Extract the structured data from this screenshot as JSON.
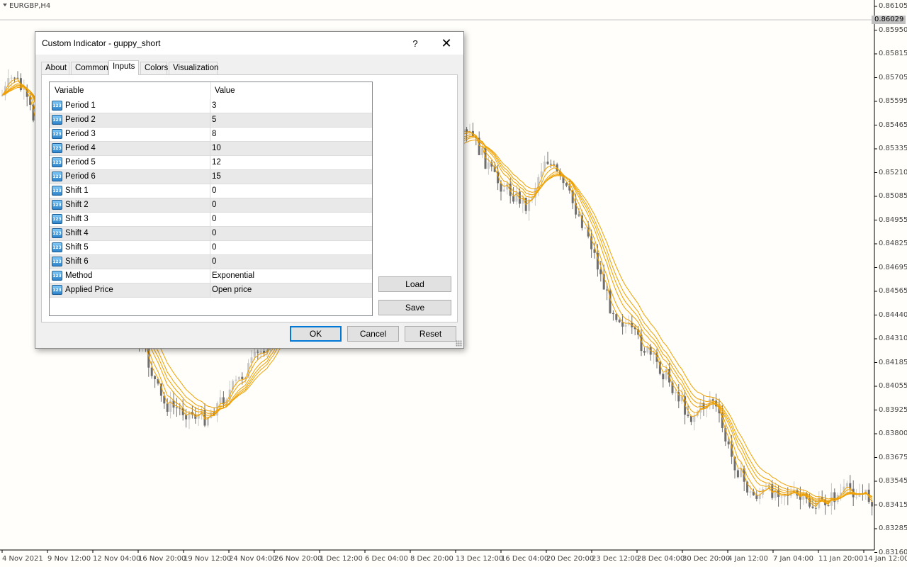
{
  "chart": {
    "symbol_label": "EURGBP,H4",
    "current_price": "0.86029",
    "y_labels": [
      "0.86105",
      "0.85950",
      "0.85815",
      "0.85705",
      "0.85595",
      "0.85465",
      "0.85335",
      "0.85210",
      "0.85085",
      "0.84955",
      "0.84825",
      "0.84695",
      "0.84565",
      "0.84440",
      "0.84310",
      "0.84185",
      "0.84055",
      "0.83925",
      "0.83800",
      "0.83675",
      "0.83545",
      "0.83415",
      "0.83285",
      "0.83160"
    ],
    "x_labels": [
      "4 Nov 2021",
      "9 Nov 12:00",
      "12 Nov 04:00",
      "16 Nov 20:00",
      "19 Nov 12:00",
      "24 Nov 04:00",
      "26 Nov 20:00",
      "1 Dec 12:00",
      "6 Dec 04:00",
      "8 Dec 20:00",
      "13 Dec 12:00",
      "16 Dec 04:00",
      "20 Dec 20:00",
      "23 Dec 12:00",
      "28 Dec 04:00",
      "30 Dec 20:00",
      "4 Jan 12:00",
      "7 Jan 04:00",
      "11 Jan 20:00",
      "14 Jan 12:00"
    ],
    "colors": {
      "ribbon": "#f0a000",
      "bull": "#c8c8c8",
      "bear": "#6e6e6e",
      "background": "#fffefa"
    }
  },
  "dialog": {
    "title": "Custom Indicator - guppy_short",
    "help_label": "?",
    "close_label": "✕",
    "tabs": [
      "About",
      "Common",
      "Inputs",
      "Colors",
      "Visualization"
    ],
    "active_tab": "Inputs",
    "table": {
      "headers": [
        "Variable",
        "Value"
      ],
      "icon_text": "123",
      "rows": [
        {
          "variable": "Period 1",
          "value": "3"
        },
        {
          "variable": "Period 2",
          "value": "5"
        },
        {
          "variable": "Period 3",
          "value": "8"
        },
        {
          "variable": "Period 4",
          "value": "10"
        },
        {
          "variable": "Period 5",
          "value": "12"
        },
        {
          "variable": "Period 6",
          "value": "15"
        },
        {
          "variable": "Shift 1",
          "value": "0"
        },
        {
          "variable": "Shift 2",
          "value": "0"
        },
        {
          "variable": "Shift 3",
          "value": "0"
        },
        {
          "variable": "Shift 4",
          "value": "0"
        },
        {
          "variable": "Shift 5",
          "value": "0"
        },
        {
          "variable": "Shift 6",
          "value": "0"
        },
        {
          "variable": "Method",
          "value": "Exponential"
        },
        {
          "variable": "Applied Price",
          "value": "Open price"
        }
      ]
    },
    "buttons": {
      "load": "Load",
      "save": "Save",
      "ok": "OK",
      "cancel": "Cancel",
      "reset": "Reset"
    }
  }
}
